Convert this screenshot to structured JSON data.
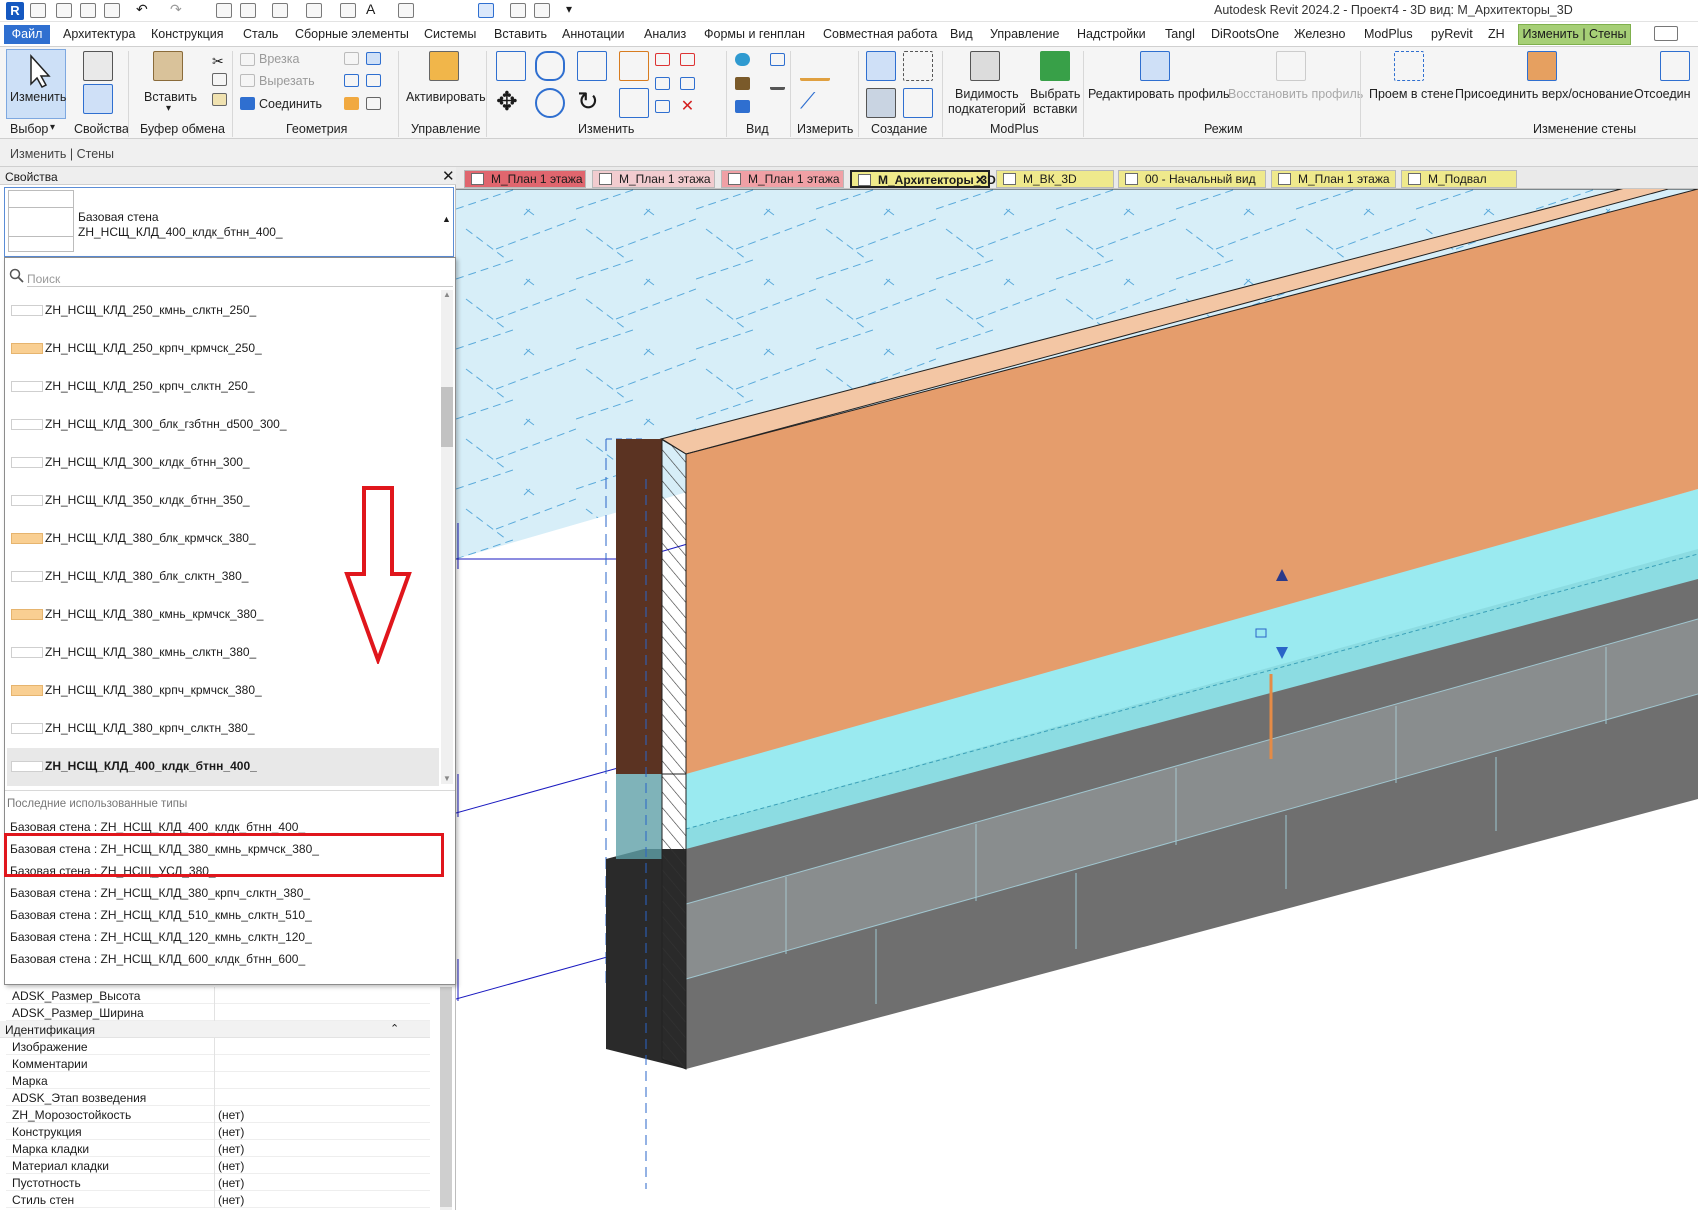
{
  "app": {
    "title": "Autodesk Revit 2024.2 - Проект4 - 3D вид: М_Архитекторы_3D",
    "logo": "R"
  },
  "menu": {
    "file": "Файл",
    "items": [
      "Архитектура",
      "Конструкция",
      "Сталь",
      "Сборные элементы",
      "Системы",
      "Вставить",
      "Аннотации",
      "Анализ",
      "Формы и генплан",
      "Совместная работа",
      "Вид",
      "Управление",
      "Надстройки",
      "Tangl",
      "DiRootsOne",
      "Железно",
      "ModPlus",
      "pyRevit",
      "ZH"
    ],
    "active": "Изменить | Стены"
  },
  "ribbon": {
    "modify_label": "Изменить",
    "select_label": "Выбор",
    "properties_label": "Свойства",
    "paste_label": "Вставить",
    "clipboard_label": "Буфер обмена",
    "cut_label": "Врезка",
    "cutout_label": "Вырезать",
    "join_label": "Соединить",
    "geometry_label": "Геометрия",
    "activate_label": "Активировать",
    "control_label": "Управление",
    "modify_group_label": "Изменить",
    "view_label": "Вид",
    "measure_label": "Измерить",
    "create_label": "Создание",
    "visibility_label_1": "Видимость",
    "visibility_label_2": "подкатегорий",
    "pick_inserts_label_1": "Выбрать",
    "pick_inserts_label_2": "вставки",
    "modplus_label": "ModPlus",
    "edit_profile_label": "Редактировать профиль",
    "restore_profile_label": "Восстановить профиль",
    "mode_label": "Режим",
    "wall_opening_label": "Проем в стене",
    "attach_label": "Присоединить верх/основание",
    "detach_label": "Отсоедин",
    "modify_wall_label": "Изменение стены"
  },
  "context_bar": "Изменить | Стены",
  "properties": {
    "header": "Свойства",
    "family": "Базовая стена",
    "type": "ZH_НСЩ_КЛД_400_клдк_бтнн_400_",
    "search_placeholder": "Поиск",
    "type_list": [
      {
        "name": "ZH_НСЩ_КЛД_250_кмнь_слктн_250_",
        "color": "white"
      },
      {
        "name": "ZH_НСЩ_КЛД_250_крпч_крмчск_250_",
        "color": "orange"
      },
      {
        "name": "ZH_НСЩ_КЛД_250_крпч_слктн_250_",
        "color": "white"
      },
      {
        "name": "ZH_НСЩ_КЛД_300_блк_гзбтнн_d500_300_",
        "color": "white"
      },
      {
        "name": "ZH_НСЩ_КЛД_300_клдк_бтнн_300_",
        "color": "white"
      },
      {
        "name": "ZH_НСЩ_КЛД_350_клдк_бтнн_350_",
        "color": "white"
      },
      {
        "name": "ZH_НСЩ_КЛД_380_блк_крмчск_380_",
        "color": "orange"
      },
      {
        "name": "ZH_НСЩ_КЛД_380_блк_слктн_380_",
        "color": "white"
      },
      {
        "name": "ZH_НСЩ_КЛД_380_кмнь_крмчск_380_",
        "color": "orange"
      },
      {
        "name": "ZH_НСЩ_КЛД_380_кмнь_слктн_380_",
        "color": "white"
      },
      {
        "name": "ZH_НСЩ_КЛД_380_крпч_крмчск_380_",
        "color": "orange"
      },
      {
        "name": "ZH_НСЩ_КЛД_380_крпч_слктн_380_",
        "color": "white"
      },
      {
        "name": "ZH_НСЩ_КЛД_400_клдк_бтнн_400_",
        "color": "white"
      }
    ],
    "recent_header": "Последние использованные типы",
    "recent": [
      "Базовая стена : ZH_НСЩ_КЛД_400_клдк_бтнн_400_",
      "Базовая стена : ZH_НСЩ_КЛД_380_кмнь_крмчск_380_",
      "Базовая стена : ZH_НСЩ_УСЛ_380_",
      "Базовая стена : ZH_НСЩ_КЛД_380_крпч_слктн_380_",
      "Базовая стена : ZH_НСЩ_КЛД_510_кмнь_слктн_510_",
      "Базовая стена : ZH_НСЩ_КЛД_120_кмнь_слктн_120_",
      "Базовая стена : ZH_НСЩ_КЛД_600_клдк_бтнн_600_"
    ],
    "rows_top": [
      {
        "key": "ADSK_Размер_Высота",
        "value": ""
      },
      {
        "key": "ADSK_Размер_Ширина",
        "value": ""
      }
    ],
    "section_ident": "Идентификация",
    "rows": [
      {
        "key": "Изображение",
        "value": ""
      },
      {
        "key": "Комментарии",
        "value": ""
      },
      {
        "key": "Марка",
        "value": ""
      },
      {
        "key": "ADSK_Этап возведения",
        "value": ""
      },
      {
        "key": "ZH_Морозостойкость",
        "value": "(нет)"
      },
      {
        "key": "Конструкция",
        "value": "(нет)"
      },
      {
        "key": "Марка кладки",
        "value": "(нет)"
      },
      {
        "key": "Материал кладки",
        "value": "(нет)"
      },
      {
        "key": "Пустотность",
        "value": "(нет)"
      },
      {
        "key": "Стиль стен",
        "value": "(нет)"
      }
    ]
  },
  "tabs": [
    {
      "label": "М_План 1 этажа",
      "color": "#e0666e",
      "active": false
    },
    {
      "label": "М_План 1 этажа",
      "color": "#f2cccf",
      "active": false
    },
    {
      "label": "М_План 1 этажа",
      "color": "#f0a0a5",
      "active": false
    },
    {
      "label": "М_Архитекторы_3D",
      "color": "#f0ea8a",
      "active": true
    },
    {
      "label": "М_ВК_3D",
      "color": "#efe98c",
      "active": false
    },
    {
      "label": "00 - Начальный вид",
      "color": "#efe98c",
      "active": false
    },
    {
      "label": "М_План 1 этажа",
      "color": "#efe98c",
      "active": false
    },
    {
      "label": "М_Подвал",
      "color": "#efe98c",
      "active": false
    }
  ],
  "colors": {
    "accent": "#2f6fd0",
    "context_tab": "#a6cf76",
    "highlight": "#e0161c",
    "wall_orange": "#e59d6c",
    "wall_dark": "#5b3322",
    "cyan": "#8fe8ee"
  }
}
